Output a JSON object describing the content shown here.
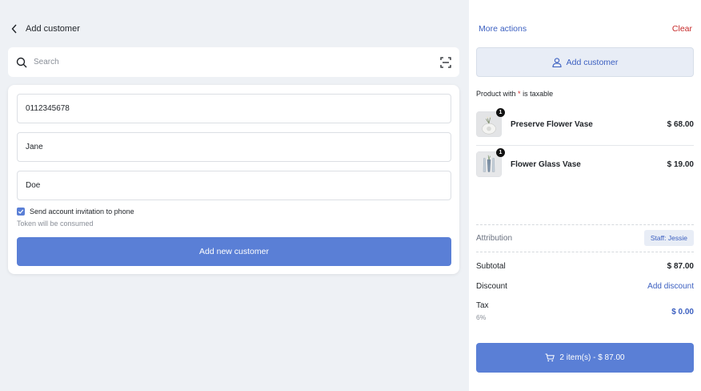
{
  "left": {
    "back_label": "Add customer",
    "search_placeholder": "Search",
    "form": {
      "phone": "0112345678",
      "first_name": "Jane",
      "last_name": "Doe",
      "invite_label": "Send account invitation to phone",
      "invite_checked": true,
      "hint": "Token will be consumed",
      "submit_label": "Add new customer"
    }
  },
  "right": {
    "more_actions": "More actions",
    "clear": "Clear",
    "add_customer": "Add customer",
    "taxable_prefix": "Product with",
    "taxable_star": "*",
    "taxable_suffix": "is taxable",
    "products": [
      {
        "name": "Preserve Flower Vase",
        "price": "$ 68.00",
        "qty": "1"
      },
      {
        "name": "Flower Glass Vase",
        "price": "$ 19.00",
        "qty": "1"
      }
    ],
    "attribution_label": "Attribution",
    "staff": "Staff: Jessie",
    "subtotal_label": "Subtotal",
    "subtotal_value": "$ 87.00",
    "discount_label": "Discount",
    "discount_action": "Add discount",
    "tax_label": "Tax",
    "tax_rate": "6%",
    "tax_value": "$ 0.00",
    "checkout_label": "2 item(s) - $ 87.00"
  },
  "colors": {
    "accent": "#5a7fd6",
    "link": "#3b5fc0",
    "danger": "#c62828",
    "background": "#eef1f5"
  },
  "icons": [
    "chevron-left-icon",
    "search-icon",
    "scan-icon",
    "check-icon",
    "user-icon",
    "cart-icon"
  ]
}
